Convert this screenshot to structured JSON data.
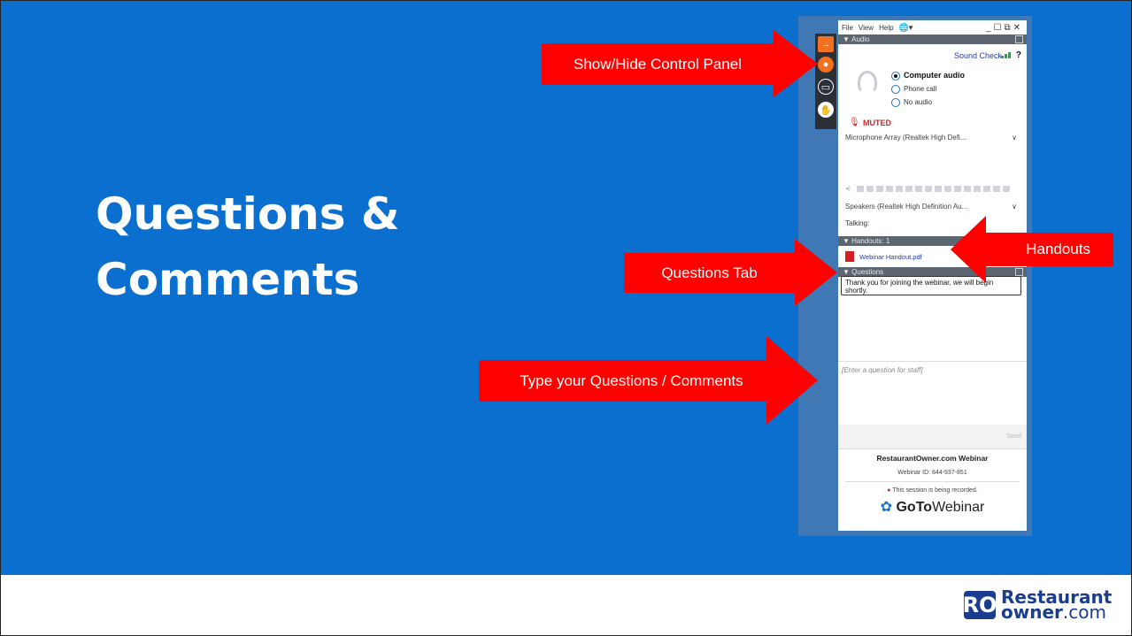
{
  "slide": {
    "title_line1": "Questions &",
    "title_line2": "Comments"
  },
  "annotations": {
    "show_hide": "Show/Hide Control Panel",
    "handouts": "Handouts",
    "questions_tab": "Questions Tab",
    "type_questions": "Type your Questions / Comments"
  },
  "panel": {
    "menu": [
      "File",
      "View",
      "Help"
    ],
    "audio_header": "Audio",
    "sound_check": "Sound Check",
    "help_mark": "?",
    "audio_options": [
      "Computer audio",
      "Phone call",
      "No audio"
    ],
    "muted": "MUTED",
    "microphone": "Microphone Array (Realtek High Defi...",
    "speakers": "Speakers (Realtek High Definition Au...",
    "talking": "Talking:",
    "handouts_header": "Handouts: 1",
    "handout_file": "Webinar Handout.pdf",
    "questions_header": "Questions",
    "message": "Thank you for joining the webinar, we will begin shortly.",
    "input_placeholder": "[Enter a question for staff]",
    "send": "Send",
    "webinar_name": "RestaurantOwner.com Webinar",
    "webinar_id": "Webinar ID: 844-937-851",
    "recording": "This session is being recorded.",
    "brand_goto": "GoTo",
    "brand_webinar": "Webinar"
  },
  "logo": {
    "mark": "RO",
    "line1": "Restaurant",
    "line2_bold": "owner",
    "line2_rest": ".com"
  },
  "colors": {
    "slide_bg": "#0a6fcf",
    "arrow": "#ff0000",
    "brand": "#1b3d8f"
  }
}
